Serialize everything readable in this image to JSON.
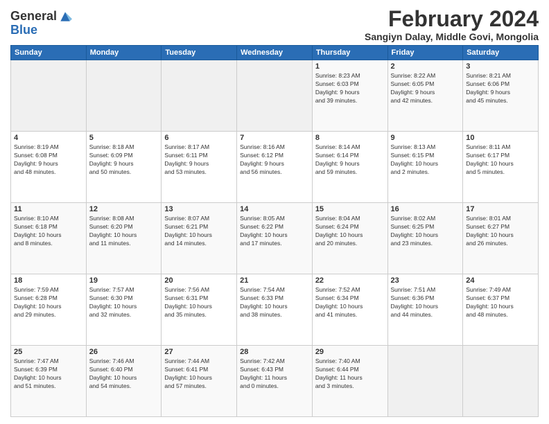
{
  "logo": {
    "line1": "General",
    "line2": "Blue"
  },
  "title": "February 2024",
  "subtitle": "Sangiyn Dalay, Middle Govi, Mongolia",
  "days_of_week": [
    "Sunday",
    "Monday",
    "Tuesday",
    "Wednesday",
    "Thursday",
    "Friday",
    "Saturday"
  ],
  "weeks": [
    [
      {
        "day": "",
        "info": ""
      },
      {
        "day": "",
        "info": ""
      },
      {
        "day": "",
        "info": ""
      },
      {
        "day": "",
        "info": ""
      },
      {
        "day": "1",
        "info": "Sunrise: 8:23 AM\nSunset: 6:03 PM\nDaylight: 9 hours\nand 39 minutes."
      },
      {
        "day": "2",
        "info": "Sunrise: 8:22 AM\nSunset: 6:05 PM\nDaylight: 9 hours\nand 42 minutes."
      },
      {
        "day": "3",
        "info": "Sunrise: 8:21 AM\nSunset: 6:06 PM\nDaylight: 9 hours\nand 45 minutes."
      }
    ],
    [
      {
        "day": "4",
        "info": "Sunrise: 8:19 AM\nSunset: 6:08 PM\nDaylight: 9 hours\nand 48 minutes."
      },
      {
        "day": "5",
        "info": "Sunrise: 8:18 AM\nSunset: 6:09 PM\nDaylight: 9 hours\nand 50 minutes."
      },
      {
        "day": "6",
        "info": "Sunrise: 8:17 AM\nSunset: 6:11 PM\nDaylight: 9 hours\nand 53 minutes."
      },
      {
        "day": "7",
        "info": "Sunrise: 8:16 AM\nSunset: 6:12 PM\nDaylight: 9 hours\nand 56 minutes."
      },
      {
        "day": "8",
        "info": "Sunrise: 8:14 AM\nSunset: 6:14 PM\nDaylight: 9 hours\nand 59 minutes."
      },
      {
        "day": "9",
        "info": "Sunrise: 8:13 AM\nSunset: 6:15 PM\nDaylight: 10 hours\nand 2 minutes."
      },
      {
        "day": "10",
        "info": "Sunrise: 8:11 AM\nSunset: 6:17 PM\nDaylight: 10 hours\nand 5 minutes."
      }
    ],
    [
      {
        "day": "11",
        "info": "Sunrise: 8:10 AM\nSunset: 6:18 PM\nDaylight: 10 hours\nand 8 minutes."
      },
      {
        "day": "12",
        "info": "Sunrise: 8:08 AM\nSunset: 6:20 PM\nDaylight: 10 hours\nand 11 minutes."
      },
      {
        "day": "13",
        "info": "Sunrise: 8:07 AM\nSunset: 6:21 PM\nDaylight: 10 hours\nand 14 minutes."
      },
      {
        "day": "14",
        "info": "Sunrise: 8:05 AM\nSunset: 6:22 PM\nDaylight: 10 hours\nand 17 minutes."
      },
      {
        "day": "15",
        "info": "Sunrise: 8:04 AM\nSunset: 6:24 PM\nDaylight: 10 hours\nand 20 minutes."
      },
      {
        "day": "16",
        "info": "Sunrise: 8:02 AM\nSunset: 6:25 PM\nDaylight: 10 hours\nand 23 minutes."
      },
      {
        "day": "17",
        "info": "Sunrise: 8:01 AM\nSunset: 6:27 PM\nDaylight: 10 hours\nand 26 minutes."
      }
    ],
    [
      {
        "day": "18",
        "info": "Sunrise: 7:59 AM\nSunset: 6:28 PM\nDaylight: 10 hours\nand 29 minutes."
      },
      {
        "day": "19",
        "info": "Sunrise: 7:57 AM\nSunset: 6:30 PM\nDaylight: 10 hours\nand 32 minutes."
      },
      {
        "day": "20",
        "info": "Sunrise: 7:56 AM\nSunset: 6:31 PM\nDaylight: 10 hours\nand 35 minutes."
      },
      {
        "day": "21",
        "info": "Sunrise: 7:54 AM\nSunset: 6:33 PM\nDaylight: 10 hours\nand 38 minutes."
      },
      {
        "day": "22",
        "info": "Sunrise: 7:52 AM\nSunset: 6:34 PM\nDaylight: 10 hours\nand 41 minutes."
      },
      {
        "day": "23",
        "info": "Sunrise: 7:51 AM\nSunset: 6:36 PM\nDaylight: 10 hours\nand 44 minutes."
      },
      {
        "day": "24",
        "info": "Sunrise: 7:49 AM\nSunset: 6:37 PM\nDaylight: 10 hours\nand 48 minutes."
      }
    ],
    [
      {
        "day": "25",
        "info": "Sunrise: 7:47 AM\nSunset: 6:39 PM\nDaylight: 10 hours\nand 51 minutes."
      },
      {
        "day": "26",
        "info": "Sunrise: 7:46 AM\nSunset: 6:40 PM\nDaylight: 10 hours\nand 54 minutes."
      },
      {
        "day": "27",
        "info": "Sunrise: 7:44 AM\nSunset: 6:41 PM\nDaylight: 10 hours\nand 57 minutes."
      },
      {
        "day": "28",
        "info": "Sunrise: 7:42 AM\nSunset: 6:43 PM\nDaylight: 11 hours\nand 0 minutes."
      },
      {
        "day": "29",
        "info": "Sunrise: 7:40 AM\nSunset: 6:44 PM\nDaylight: 11 hours\nand 3 minutes."
      },
      {
        "day": "",
        "info": ""
      },
      {
        "day": "",
        "info": ""
      }
    ]
  ]
}
